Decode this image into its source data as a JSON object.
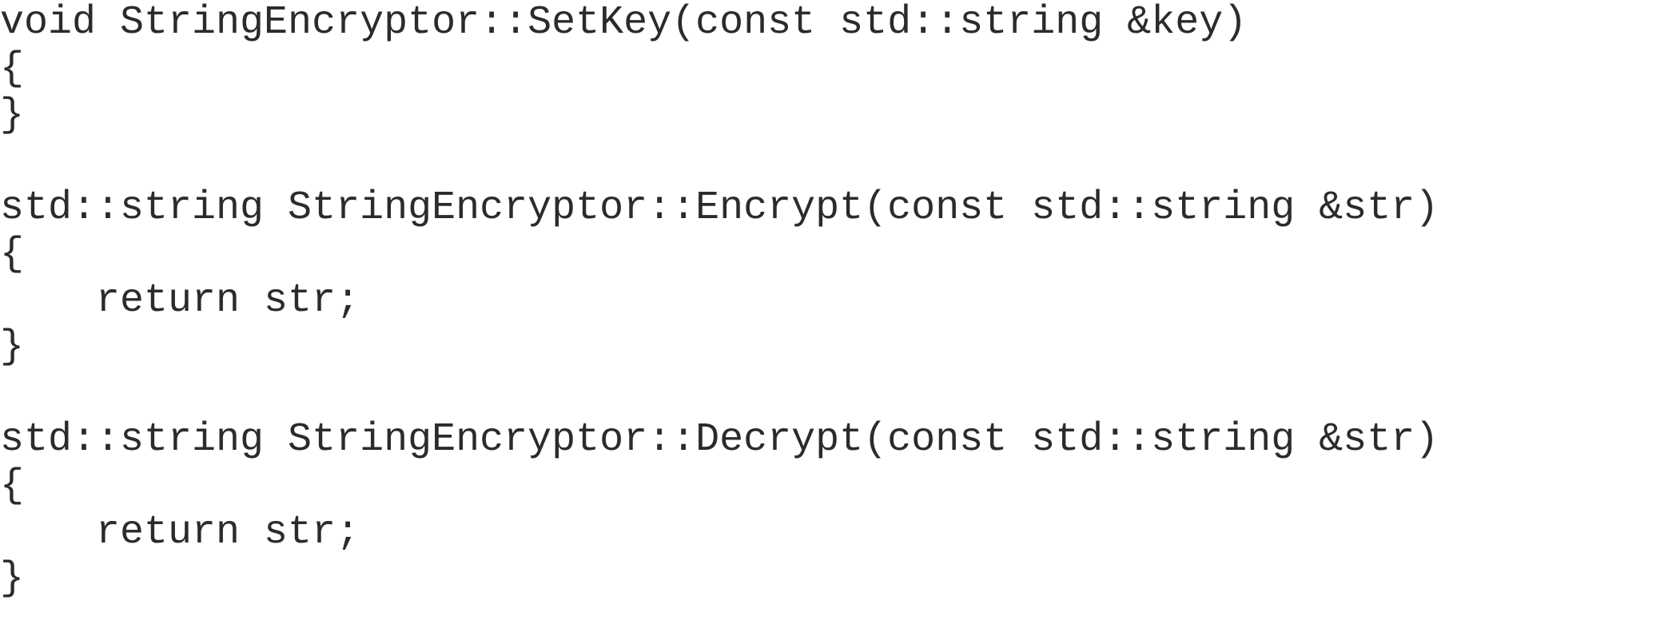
{
  "code": {
    "lines": [
      "void StringEncryptor::SetKey(const std::string &key)",
      "{",
      "}",
      "",
      "std::string StringEncryptor::Encrypt(const std::string &str)",
      "{",
      "    return str;",
      "}",
      "",
      "std::string StringEncryptor::Decrypt(const std::string &str)",
      "{",
      "    return str;",
      "}"
    ]
  }
}
